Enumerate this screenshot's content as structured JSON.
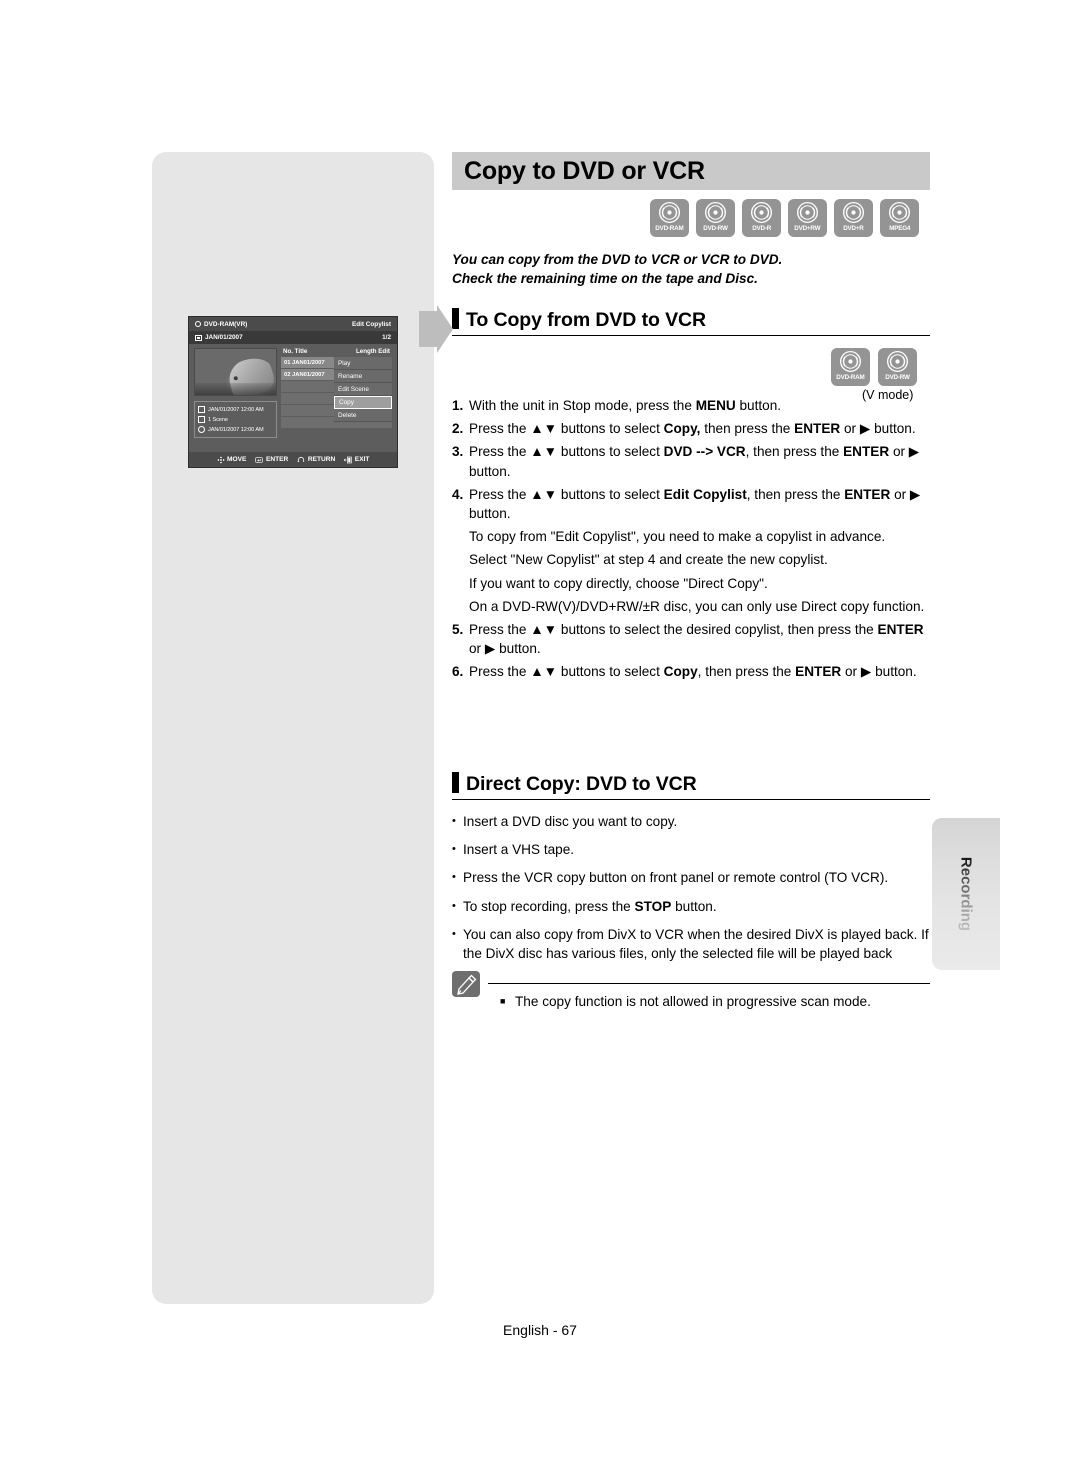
{
  "page": {
    "title": "Copy to DVD or VCR",
    "footer": "English - 67",
    "side_tab": "Recording"
  },
  "disc_icons_main": [
    {
      "label": "DVD-RAM",
      "name": "dvd-ram-icon"
    },
    {
      "label": "DVD-RW",
      "name": "dvd-rw-icon"
    },
    {
      "label": "DVD-R",
      "name": "dvd-r-icon"
    },
    {
      "label": "DVD+RW",
      "name": "dvd-plus-rw-icon"
    },
    {
      "label": "DVD+R",
      "name": "dvd-plus-r-icon"
    },
    {
      "label": "MPEG4",
      "name": "mpeg4-icon"
    }
  ],
  "disc_icons_section": [
    {
      "label": "DVD-RAM",
      "name": "dvd-ram-icon"
    },
    {
      "label": "DVD-RW",
      "name": "dvd-rw-icon"
    }
  ],
  "v_mode_caption": "(V mode)",
  "intro": {
    "line1": "You can copy from the DVD to VCR or VCR to DVD.",
    "line2": "Check the remaining time on the tape and Disc."
  },
  "section_dvd_to_vcr": {
    "heading": "To Copy from DVD to VCR",
    "steps": [
      {
        "num": "1.",
        "parts": [
          {
            "t": "With the unit in Stop mode, press the ",
            "b": false
          },
          {
            "t": "MENU",
            "b": true
          },
          {
            "t": " button.",
            "b": false
          }
        ]
      },
      {
        "num": "2.",
        "parts": [
          {
            "t": "Press the ",
            "b": false
          },
          {
            "t": "▲▼",
            "b": false
          },
          {
            "t": " buttons to select ",
            "b": false
          },
          {
            "t": "Copy,",
            "b": true
          },
          {
            "t": " then press the ",
            "b": false
          },
          {
            "t": "ENTER",
            "b": true
          },
          {
            "t": " or ▶ button.",
            "b": false
          }
        ]
      },
      {
        "num": "3.",
        "parts": [
          {
            "t": "Press the ",
            "b": false
          },
          {
            "t": "▲▼",
            "b": false
          },
          {
            "t": " buttons to select ",
            "b": false
          },
          {
            "t": "DVD --> VCR",
            "b": true
          },
          {
            "t": ", then press the ",
            "b": false
          },
          {
            "t": "ENTER",
            "b": true
          },
          {
            "t": " or ▶ button.",
            "b": false
          }
        ]
      },
      {
        "num": "4.",
        "parts": [
          {
            "t": "Press the ",
            "b": false
          },
          {
            "t": "▲▼",
            "b": false
          },
          {
            "t": " buttons to select ",
            "b": false
          },
          {
            "t": "Edit Copylist",
            "b": true
          },
          {
            "t": ", then press the ",
            "b": false
          },
          {
            "t": "ENTER",
            "b": true
          },
          {
            "t": " or ▶ button.",
            "b": false
          }
        ]
      }
    ],
    "explanation": [
      "To copy from \"Edit Copylist\", you need to make a copylist in advance.",
      "Select \"New Copylist\" at step 4 and create the new copylist.",
      "If you want to copy directly, choose \"Direct Copy\".",
      "On a DVD-RW(V)/DVD+RW/±R disc, you can only use Direct copy function."
    ],
    "steps2": [
      {
        "num": "5.",
        "parts": [
          {
            "t": "Press the ",
            "b": false
          },
          {
            "t": "▲▼",
            "b": false
          },
          {
            "t": " buttons to select the desired copylist, then press the ",
            "b": false
          },
          {
            "t": "ENTER",
            "b": true
          },
          {
            "t": " or ▶ button.",
            "b": false
          }
        ]
      },
      {
        "num": "6.",
        "parts": [
          {
            "t": "Press the ",
            "b": false
          },
          {
            "t": "▲▼",
            "b": false
          },
          {
            "t": " buttons to select ",
            "b": false
          },
          {
            "t": "Copy",
            "b": true
          },
          {
            "t": ", then press the ",
            "b": false
          },
          {
            "t": "ENTER",
            "b": true
          },
          {
            "t": " or ▶ button.",
            "b": false
          }
        ]
      }
    ]
  },
  "section_direct_copy": {
    "heading": "Direct Copy: DVD to VCR",
    "bullets": [
      [
        {
          "t": "Insert a DVD disc you want to copy.",
          "b": false
        }
      ],
      [
        {
          "t": "Insert a VHS tape.",
          "b": false
        }
      ],
      [
        {
          "t": "Press the VCR copy button on front panel or remote control (TO VCR).",
          "b": false
        }
      ],
      [
        {
          "t": "To stop recording, press the ",
          "b": false
        },
        {
          "t": "STOP",
          "b": true
        },
        {
          "t": " button.",
          "b": false
        }
      ],
      [
        {
          "t": "You can also copy from DivX to VCR when the desired DivX is played back. If the DivX disc has various files, only the selected file will be played back",
          "b": false
        }
      ]
    ]
  },
  "note": {
    "icon": "pencil-icon",
    "bullet_symbol": "■",
    "text": "The copy function is not allowed in progressive scan mode."
  },
  "osd": {
    "disc_type": "DVD-RAM(VR)",
    "mode_title": "Edit Copylist",
    "date": "JAN/01/2007",
    "page_indicator": "1/2",
    "list_headers": {
      "left": "No. Title",
      "right": "Length Edit"
    },
    "titles": [
      {
        "text": "01 JAN01/2007",
        "filled": true
      },
      {
        "text": "02 JAN01/2007",
        "filled": true
      },
      {
        "text": "",
        "filled": false
      },
      {
        "text": "",
        "filled": false
      },
      {
        "text": "",
        "filled": false
      },
      {
        "text": "",
        "filled": false
      }
    ],
    "popup_menu": [
      {
        "label": "Play",
        "selected": false
      },
      {
        "label": "Rename",
        "selected": false
      },
      {
        "label": "Edit Scene",
        "selected": false
      },
      {
        "label": "Copy",
        "selected": true
      },
      {
        "label": "Delete",
        "selected": false
      }
    ],
    "info": [
      {
        "icon": "calendar-icon",
        "text": "JAN/01/2007 12:00 AM"
      },
      {
        "icon": "scene-icon",
        "text": "1 Scene"
      },
      {
        "icon": "clock-icon",
        "text": "JAN/01/2007 12:00 AM"
      }
    ],
    "footer_keys": [
      {
        "icon": "dpad-icon",
        "label": "MOVE"
      },
      {
        "icon": "enter-icon",
        "label": "ENTER"
      },
      {
        "icon": "return-icon",
        "label": "RETURN"
      },
      {
        "icon": "exit-icon",
        "label": "EXIT"
      }
    ]
  }
}
